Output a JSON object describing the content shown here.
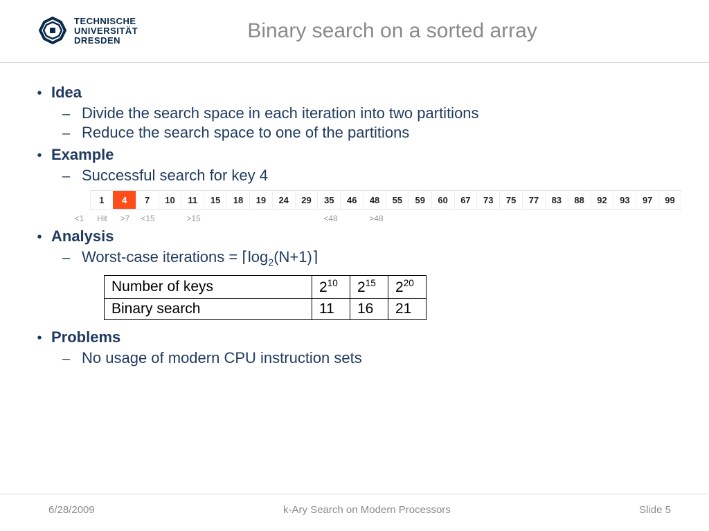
{
  "header": {
    "logo": {
      "line1": "TECHNISCHE",
      "line2": "UNIVERSITÄT",
      "line3": "DRESDEN"
    },
    "title": "Binary search on a sorted array"
  },
  "sections": [
    {
      "heading": "Idea",
      "items": [
        "Divide the search space in each iteration into two partitions",
        "Reduce the search space to one of the partitions"
      ]
    },
    {
      "heading": "Example",
      "items": [
        "Successful search for key 4"
      ]
    },
    {
      "heading": "Analysis",
      "formula_prefix": "Worst-case iterations = ",
      "log_base": "2"
    },
    {
      "heading": "Problems",
      "items": [
        "No usage of modern CPU instruction sets"
      ]
    }
  ],
  "array": {
    "values": [
      1,
      4,
      7,
      10,
      11,
      15,
      18,
      19,
      24,
      29,
      35,
      46,
      48,
      55,
      59,
      60,
      67,
      73,
      75,
      77,
      83,
      88,
      92,
      93,
      97,
      99
    ],
    "highlight_index": 1
  },
  "annotations": [
    "<1",
    "Hit",
    ">7",
    "<15",
    "",
    ">15",
    "",
    "",
    "",
    "",
    "",
    "<48",
    "",
    ">48"
  ],
  "table": {
    "rows": [
      {
        "label": "Number of keys",
        "exps": [
          "10",
          "15",
          "20"
        ]
      },
      {
        "label": "Binary search",
        "vals": [
          "11",
          "16",
          "21"
        ]
      }
    ]
  },
  "footer": {
    "date": "6/28/2009",
    "presentation": "k-Ary Search on Modern Processors",
    "slide": "Slide 5"
  }
}
